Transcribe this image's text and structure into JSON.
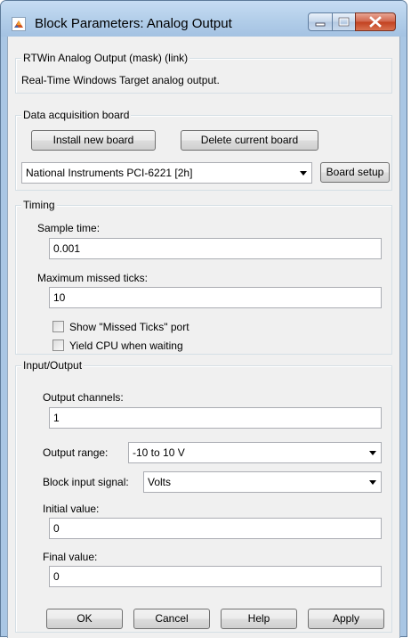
{
  "window": {
    "title": "Block Parameters: Analog Output"
  },
  "icons": [
    "matlab-logo-icon",
    "minimize-icon",
    "maximize-icon",
    "close-icon",
    "dropdown-arrow-icon"
  ],
  "colors": {
    "titlebar": "#b0cce8",
    "close_button": "#c2401f",
    "dialog_bg": "#f0f0f0"
  },
  "mask": {
    "legend": "RTWin Analog Output (mask) (link)",
    "description": "Real-Time Windows Target analog output."
  },
  "daq": {
    "legend": "Data acquisition board",
    "install_label": "Install new board",
    "delete_label": "Delete current board",
    "board_selected": "National Instruments PCI-6221 [2h]",
    "board_setup_label": "Board setup"
  },
  "timing": {
    "legend": "Timing",
    "sample_time_label": "Sample time:",
    "sample_time_value": "0.001",
    "max_missed_label": "Maximum missed ticks:",
    "max_missed_value": "10",
    "show_missed_label": "Show \"Missed Ticks\" port",
    "show_missed_checked": false,
    "yield_cpu_label": "Yield CPU when waiting",
    "yield_cpu_checked": false
  },
  "io": {
    "legend": "Input/Output",
    "output_channels_label": "Output channels:",
    "output_channels_value": "1",
    "output_range_label": "Output range:",
    "output_range_value": "-10 to 10 V",
    "block_input_label": "Block input signal:",
    "block_input_value": "Volts",
    "initial_value_label": "Initial value:",
    "initial_value_value": "0",
    "final_value_label": "Final value:",
    "final_value_value": "0"
  },
  "footer": {
    "ok_label": "OK",
    "cancel_label": "Cancel",
    "help_label": "Help",
    "apply_label": "Apply"
  }
}
